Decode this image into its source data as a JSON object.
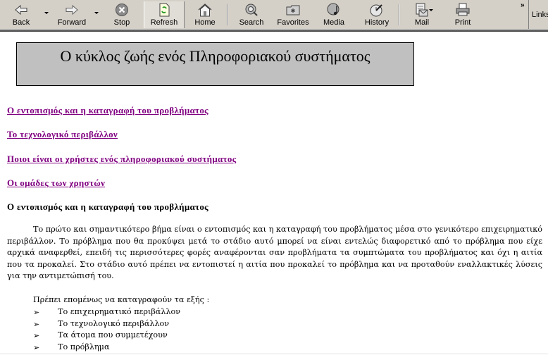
{
  "toolbar": {
    "buttons": [
      {
        "id": "back",
        "label": "Back",
        "icon": "back-arrow-icon",
        "has_dropdown": true
      },
      {
        "id": "forward",
        "label": "Forward",
        "icon": "forward-arrow-icon",
        "has_dropdown": true
      },
      {
        "id": "stop",
        "label": "Stop",
        "icon": "stop-icon"
      },
      {
        "id": "refresh",
        "label": "Refresh",
        "icon": "refresh-icon",
        "pressed": true
      },
      {
        "id": "home",
        "label": "Home",
        "icon": "home-icon"
      },
      {
        "id": "search",
        "label": "Search",
        "icon": "search-icon"
      },
      {
        "id": "favorites",
        "label": "Favorites",
        "icon": "favorites-folder-icon"
      },
      {
        "id": "media",
        "label": "Media",
        "icon": "media-icon"
      },
      {
        "id": "history",
        "label": "History",
        "icon": "history-clock-icon"
      },
      {
        "id": "mail",
        "label": "Mail",
        "icon": "mail-icon",
        "has_dropdown": true
      },
      {
        "id": "print",
        "label": "Print",
        "icon": "printer-icon"
      }
    ],
    "overflow_label": "»",
    "links_label": "Links"
  },
  "page": {
    "title": "Ο κύκλος ζωής ενός Πληροφοριακού συστήματος",
    "toc": [
      "Ο εντοπισμός και η καταγραφή του προβλήματος",
      "Το τεχνολογικό περιβάλλον",
      "Ποιοι είναι οι χρήστες ενός πληροφοριακού συστήματος",
      "Οι ομάδες των χρηστών"
    ],
    "section_heading": "Ο εντοπισμός και η καταγραφή του προβλήματος",
    "paragraph": "Το πρώτο και σημαντικότερο βήμα  είναι ο εντοπισμός και η καταγραφή του προβλήματος μέσα στο γενικότερο επιχειρηματικό περιβάλλον. Το πρόβλημα που θα προκύψει μετά το στάδιο αυτό μπορεί να είναι εντελώς διαφορετικό από το πρόβλημα που είχε αρχικά αναφερθεί, επειδή τις περισσότερες φορές αναφέρονται σαν προβλήματα τα συμπτώματα του προβλήματος και όχι η αιτία που τα προκαλεί. Στο στάδιο αυτό πρέπει να εντοπιστεί η αιτία που προκαλεί το πρόβλημα και να προταθούν εναλλακτικές λύσεις για την αντιμετώπισή του.",
    "list_intro": "Πρέπει επομένως να καταγραφούν τα εξής :",
    "bullet_glyph": "➢",
    "list_items": [
      "Το επιχειρηματικό περιβάλλον",
      "Το τεχνολογικό περιβάλλον",
      "Τα άτομα που συμμετέχουν",
      "Το πρόβλημα"
    ]
  }
}
